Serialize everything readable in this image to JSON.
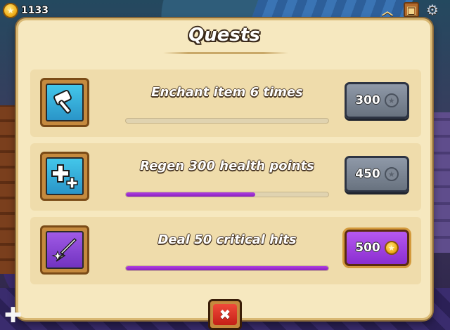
{
  "top_bar": {
    "coin_count": "1133",
    "coin_icon": "star-coin-icon",
    "icons": [
      "chevron-up-icon",
      "chest-icon",
      "gear-icon"
    ]
  },
  "panel": {
    "title": "Quests"
  },
  "quests": [
    {
      "icon": "hammer-icon",
      "text": "Enchant item 6 times",
      "progress": 0.0,
      "reward": "300",
      "reward_state": "locked"
    },
    {
      "icon": "health-plus-icon",
      "text": "Regen 300 health points",
      "progress": 0.64,
      "reward": "450",
      "reward_state": "locked"
    },
    {
      "icon": "critical-hit-icon",
      "text": "Deal 50 critical hits",
      "progress": 1.0,
      "reward": "500",
      "reward_state": "claimable"
    }
  ],
  "close_button": {
    "label": "✖"
  },
  "colors": {
    "panel_bg": "#f6e8bf",
    "progress_fill": "#9a2ed0",
    "reward_locked": "#7d8693",
    "reward_ready": "#a046e0",
    "close_red": "#e0352a"
  }
}
